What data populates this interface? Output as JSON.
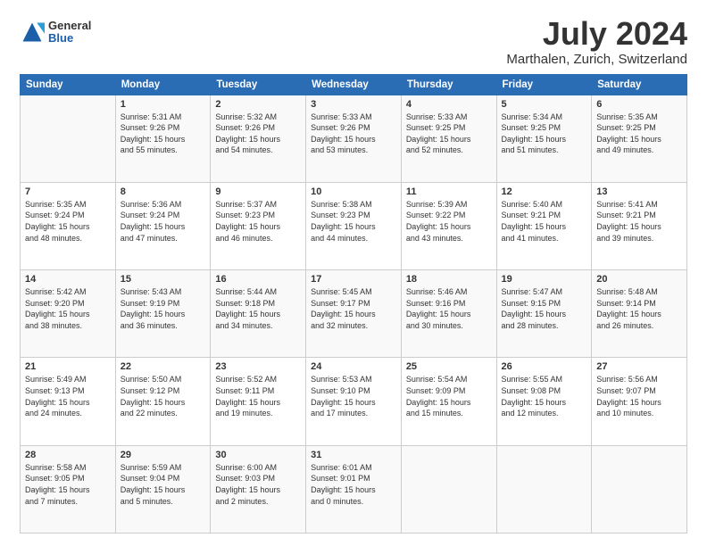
{
  "logo": {
    "general": "General",
    "blue": "Blue"
  },
  "header": {
    "title": "July 2024",
    "subtitle": "Marthalen, Zurich, Switzerland"
  },
  "weekdays": [
    "Sunday",
    "Monday",
    "Tuesday",
    "Wednesday",
    "Thursday",
    "Friday",
    "Saturday"
  ],
  "weeks": [
    [
      {
        "day": "",
        "info": ""
      },
      {
        "day": "1",
        "info": "Sunrise: 5:31 AM\nSunset: 9:26 PM\nDaylight: 15 hours\nand 55 minutes."
      },
      {
        "day": "2",
        "info": "Sunrise: 5:32 AM\nSunset: 9:26 PM\nDaylight: 15 hours\nand 54 minutes."
      },
      {
        "day": "3",
        "info": "Sunrise: 5:33 AM\nSunset: 9:26 PM\nDaylight: 15 hours\nand 53 minutes."
      },
      {
        "day": "4",
        "info": "Sunrise: 5:33 AM\nSunset: 9:25 PM\nDaylight: 15 hours\nand 52 minutes."
      },
      {
        "day": "5",
        "info": "Sunrise: 5:34 AM\nSunset: 9:25 PM\nDaylight: 15 hours\nand 51 minutes."
      },
      {
        "day": "6",
        "info": "Sunrise: 5:35 AM\nSunset: 9:25 PM\nDaylight: 15 hours\nand 49 minutes."
      }
    ],
    [
      {
        "day": "7",
        "info": "Sunrise: 5:35 AM\nSunset: 9:24 PM\nDaylight: 15 hours\nand 48 minutes."
      },
      {
        "day": "8",
        "info": "Sunrise: 5:36 AM\nSunset: 9:24 PM\nDaylight: 15 hours\nand 47 minutes."
      },
      {
        "day": "9",
        "info": "Sunrise: 5:37 AM\nSunset: 9:23 PM\nDaylight: 15 hours\nand 46 minutes."
      },
      {
        "day": "10",
        "info": "Sunrise: 5:38 AM\nSunset: 9:23 PM\nDaylight: 15 hours\nand 44 minutes."
      },
      {
        "day": "11",
        "info": "Sunrise: 5:39 AM\nSunset: 9:22 PM\nDaylight: 15 hours\nand 43 minutes."
      },
      {
        "day": "12",
        "info": "Sunrise: 5:40 AM\nSunset: 9:21 PM\nDaylight: 15 hours\nand 41 minutes."
      },
      {
        "day": "13",
        "info": "Sunrise: 5:41 AM\nSunset: 9:21 PM\nDaylight: 15 hours\nand 39 minutes."
      }
    ],
    [
      {
        "day": "14",
        "info": "Sunrise: 5:42 AM\nSunset: 9:20 PM\nDaylight: 15 hours\nand 38 minutes."
      },
      {
        "day": "15",
        "info": "Sunrise: 5:43 AM\nSunset: 9:19 PM\nDaylight: 15 hours\nand 36 minutes."
      },
      {
        "day": "16",
        "info": "Sunrise: 5:44 AM\nSunset: 9:18 PM\nDaylight: 15 hours\nand 34 minutes."
      },
      {
        "day": "17",
        "info": "Sunrise: 5:45 AM\nSunset: 9:17 PM\nDaylight: 15 hours\nand 32 minutes."
      },
      {
        "day": "18",
        "info": "Sunrise: 5:46 AM\nSunset: 9:16 PM\nDaylight: 15 hours\nand 30 minutes."
      },
      {
        "day": "19",
        "info": "Sunrise: 5:47 AM\nSunset: 9:15 PM\nDaylight: 15 hours\nand 28 minutes."
      },
      {
        "day": "20",
        "info": "Sunrise: 5:48 AM\nSunset: 9:14 PM\nDaylight: 15 hours\nand 26 minutes."
      }
    ],
    [
      {
        "day": "21",
        "info": "Sunrise: 5:49 AM\nSunset: 9:13 PM\nDaylight: 15 hours\nand 24 minutes."
      },
      {
        "day": "22",
        "info": "Sunrise: 5:50 AM\nSunset: 9:12 PM\nDaylight: 15 hours\nand 22 minutes."
      },
      {
        "day": "23",
        "info": "Sunrise: 5:52 AM\nSunset: 9:11 PM\nDaylight: 15 hours\nand 19 minutes."
      },
      {
        "day": "24",
        "info": "Sunrise: 5:53 AM\nSunset: 9:10 PM\nDaylight: 15 hours\nand 17 minutes."
      },
      {
        "day": "25",
        "info": "Sunrise: 5:54 AM\nSunset: 9:09 PM\nDaylight: 15 hours\nand 15 minutes."
      },
      {
        "day": "26",
        "info": "Sunrise: 5:55 AM\nSunset: 9:08 PM\nDaylight: 15 hours\nand 12 minutes."
      },
      {
        "day": "27",
        "info": "Sunrise: 5:56 AM\nSunset: 9:07 PM\nDaylight: 15 hours\nand 10 minutes."
      }
    ],
    [
      {
        "day": "28",
        "info": "Sunrise: 5:58 AM\nSunset: 9:05 PM\nDaylight: 15 hours\nand 7 minutes."
      },
      {
        "day": "29",
        "info": "Sunrise: 5:59 AM\nSunset: 9:04 PM\nDaylight: 15 hours\nand 5 minutes."
      },
      {
        "day": "30",
        "info": "Sunrise: 6:00 AM\nSunset: 9:03 PM\nDaylight: 15 hours\nand 2 minutes."
      },
      {
        "day": "31",
        "info": "Sunrise: 6:01 AM\nSunset: 9:01 PM\nDaylight: 15 hours\nand 0 minutes."
      },
      {
        "day": "",
        "info": ""
      },
      {
        "day": "",
        "info": ""
      },
      {
        "day": "",
        "info": ""
      }
    ]
  ]
}
